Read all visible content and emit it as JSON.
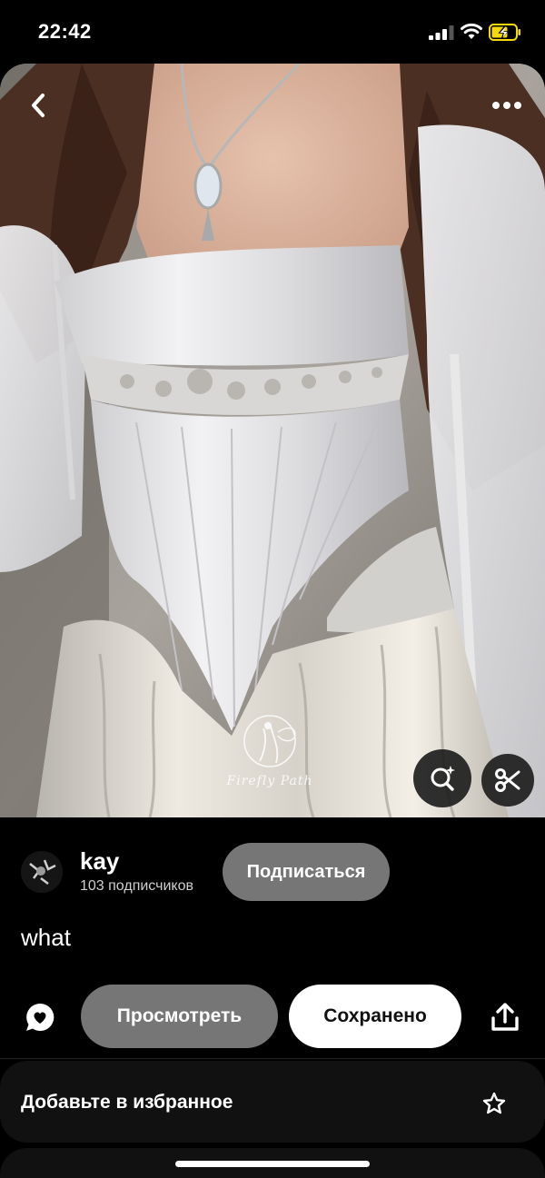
{
  "status_bar": {
    "time": "22:42",
    "signal_icon": "cellular-signal-icon",
    "wifi_icon": "wifi-icon",
    "battery_icon": "battery-charging-icon",
    "battery_color": "#f5d90a"
  },
  "pin": {
    "image_alt": "White corset gown with lace embroidery",
    "watermark": "Firefly Path",
    "title": "what"
  },
  "author": {
    "name": "kay",
    "followers": "103 подписчиков",
    "follow_label": "Подписаться"
  },
  "actions": {
    "view_label": "Просмотреть",
    "saved_label": "Сохранено"
  },
  "favorites": {
    "label": "Добавьте в избранное"
  },
  "colors": {
    "background": "#000000",
    "button_gray": "#767676",
    "button_white": "#ffffff"
  }
}
